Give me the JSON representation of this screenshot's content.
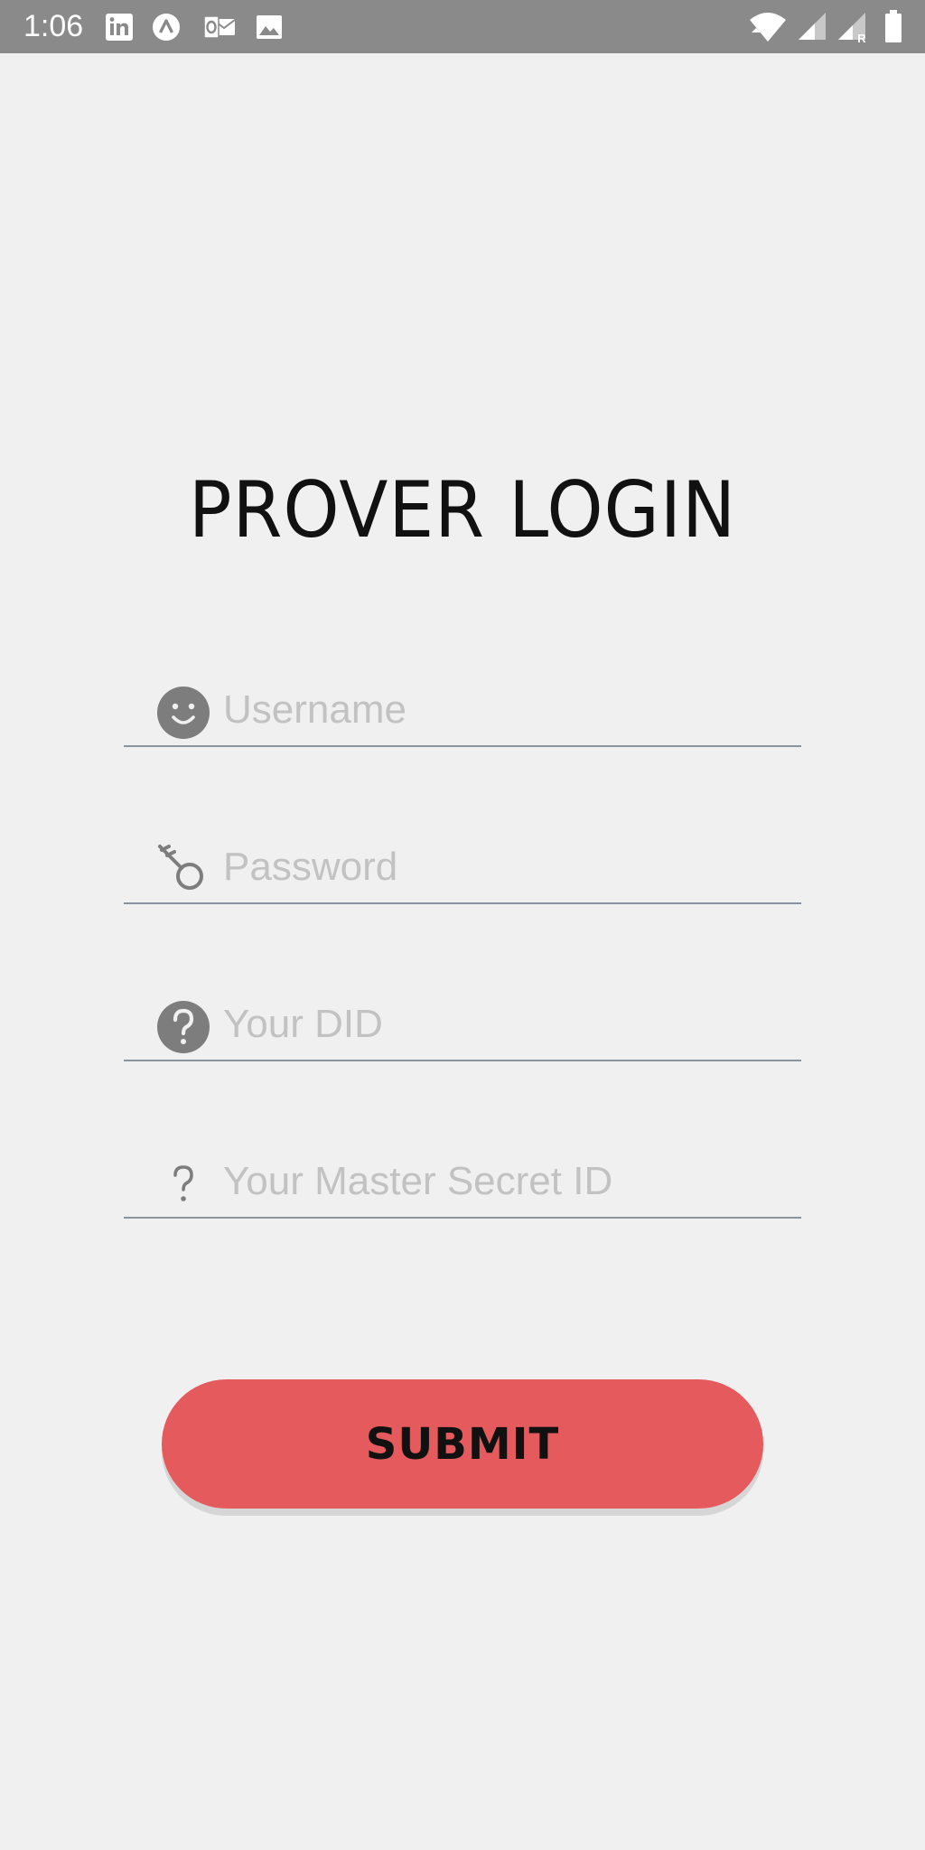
{
  "status_bar": {
    "time": "1:06",
    "left_icons": [
      "linkedin-icon",
      "nav-arrow-icon",
      "outlook-icon",
      "image-icon"
    ],
    "right_icons": [
      "wifi-icon",
      "signal-icon",
      "signal-roaming-icon",
      "battery-icon"
    ],
    "roaming_indicator": "R",
    "background_color": "#8a8a8a"
  },
  "page": {
    "title": "PROVER LOGIN",
    "background_color": "#f0f0f0"
  },
  "form": {
    "username": {
      "placeholder": "Username",
      "value": "",
      "icon": "smiley-icon"
    },
    "password": {
      "placeholder": "Password",
      "value": "",
      "icon": "key-icon"
    },
    "did": {
      "placeholder": "Your DID",
      "value": "",
      "icon": "help-circle-icon"
    },
    "master_secret": {
      "placeholder": "Your Master Secret ID",
      "value": "",
      "icon": "question-mark-icon"
    }
  },
  "submit": {
    "label": "SUBMIT",
    "color": "#e55a5c"
  }
}
